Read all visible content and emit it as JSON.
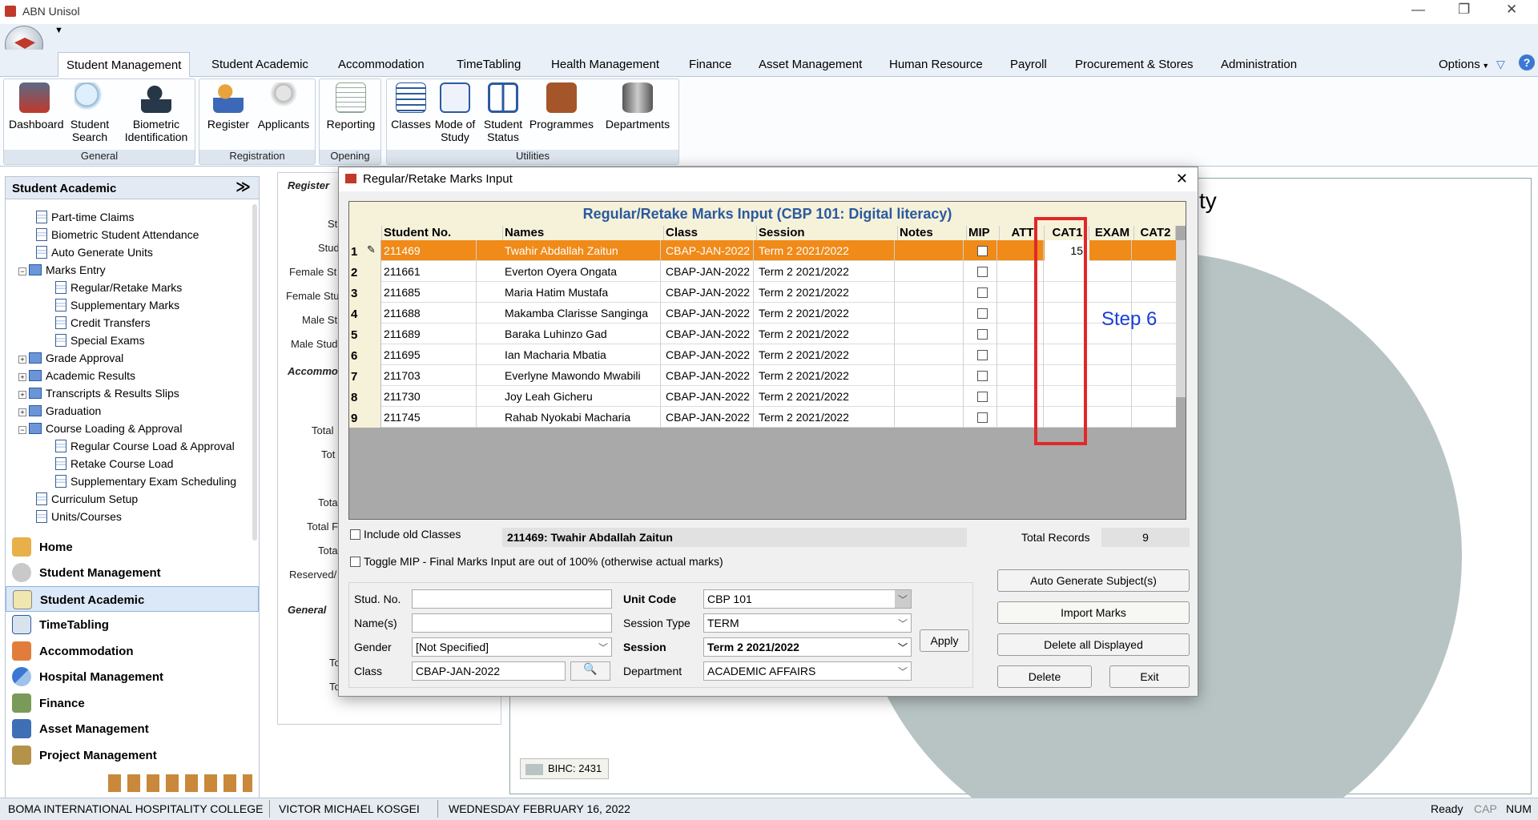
{
  "app": {
    "title": "ABN Unisol"
  },
  "window_controls": {
    "minimize": "—",
    "restore": "❐",
    "close": "✕"
  },
  "tabs": [
    "Student Management",
    "Student Academic",
    "Accommodation",
    "TimeTabling",
    "Health Management",
    "Finance",
    "Asset Management",
    "Human Resource",
    "Payroll",
    "Procurement & Stores",
    "Administration"
  ],
  "options_label": "Options",
  "ribbon": {
    "general": {
      "label": "General",
      "buttons": [
        "Dashboard",
        "Student Search",
        "Biometric Identification"
      ]
    },
    "registration": {
      "label": "Registration",
      "buttons": [
        "Register",
        "Applicants"
      ]
    },
    "opening": {
      "label": "Opening",
      "buttons": [
        "Reporting"
      ]
    },
    "utilities": {
      "label": "Utilities",
      "buttons": [
        "Classes",
        "Mode of Study",
        "Student Status",
        "Programmes",
        "Departments"
      ]
    }
  },
  "left_panel": {
    "title": "Student Academic",
    "tree": [
      "Part-time Claims",
      "Biometric Student Attendance",
      "Auto Generate Units",
      "Marks Entry",
      "Regular/Retake Marks",
      "Supplementary Marks",
      "Credit Transfers",
      "Special Exams",
      "Grade Approval",
      "Academic Results",
      "Transcripts & Results Slips",
      "Graduation",
      "Course Loading & Approval",
      "Regular Course Load & Approval",
      "Retake Course Load",
      "Supplementary Exam Scheduling",
      "Curriculum Setup",
      "Units/Courses"
    ],
    "nav": [
      "Home",
      "Student Management",
      "Student Academic",
      "TimeTabling",
      "Accommodation",
      "Hospital Management",
      "Finance",
      "Asset Management",
      "Project Management"
    ]
  },
  "bg_form": {
    "register": "Register",
    "accommodation": "Accommo",
    "general": "General",
    "labels": [
      "St",
      "Stud",
      "Female St",
      "Female Stu",
      "Male St",
      "Male Stud",
      "Total",
      "Tot",
      "Tota",
      "Total F",
      "Tota",
      "Reserved/",
      "To",
      "To"
    ]
  },
  "chart_bg": {
    "title_fragment": "ty",
    "bihc": "BIHC: 2431"
  },
  "dialog": {
    "title": "Regular/Retake Marks Input",
    "grid_title": "Regular/Retake Marks Input (CBP 101: Digital literacy)",
    "columns": [
      "Student No.",
      "Names",
      "Class",
      "Session",
      "Notes",
      "MIP",
      "ATT",
      "CAT1",
      "EXAM",
      "CAT2"
    ],
    "rows": [
      {
        "n": "1",
        "no": "211469",
        "name": "Twahir Abdallah Zaitun",
        "class": "CBAP-JAN-2022",
        "session": "Term 2 2021/2022",
        "cat1": "15"
      },
      {
        "n": "2",
        "no": "211661",
        "name": "Everton Oyera Ongata",
        "class": "CBAP-JAN-2022",
        "session": "Term 2 2021/2022",
        "cat1": ""
      },
      {
        "n": "3",
        "no": "211685",
        "name": "Maria Hatim Mustafa",
        "class": "CBAP-JAN-2022",
        "session": "Term 2 2021/2022",
        "cat1": ""
      },
      {
        "n": "4",
        "no": "211688",
        "name": "Makamba Clarisse Sanginga",
        "class": "CBAP-JAN-2022",
        "session": "Term 2 2021/2022",
        "cat1": ""
      },
      {
        "n": "5",
        "no": "211689",
        "name": "Baraka Luhinzo Gad",
        "class": "CBAP-JAN-2022",
        "session": "Term 2 2021/2022",
        "cat1": ""
      },
      {
        "n": "6",
        "no": "211695",
        "name": "Ian Macharia Mbatia",
        "class": "CBAP-JAN-2022",
        "session": "Term 2 2021/2022",
        "cat1": ""
      },
      {
        "n": "7",
        "no": "211703",
        "name": "Everlyne Mawondo Mwabili",
        "class": "CBAP-JAN-2022",
        "session": "Term 2 2021/2022",
        "cat1": ""
      },
      {
        "n": "8",
        "no": "211730",
        "name": "Joy Leah Gicheru",
        "class": "CBAP-JAN-2022",
        "session": "Term 2 2021/2022",
        "cat1": ""
      },
      {
        "n": "9",
        "no": "211745",
        "name": "Rahab Nyokabi Macharia",
        "class": "CBAP-JAN-2022",
        "session": "Term 2 2021/2022",
        "cat1": ""
      }
    ],
    "annotation": "Step 6",
    "include_old": "Include old Classes",
    "selected_student": "211469: Twahir Abdallah Zaitun",
    "total_records_label": "Total Records",
    "total_records": "9",
    "toggle_mip": "Toggle MIP - Final Marks Input are out of 100% (otherwise actual marks)",
    "filters": {
      "stud_no_label": "Stud. No.",
      "stud_no": "",
      "names_label": "Name(s)",
      "names": "",
      "gender_label": "Gender",
      "gender": "[Not Specified]",
      "class_label": "Class",
      "class": "CBAP-JAN-2022",
      "unit_code_label": "Unit Code",
      "unit_code": "CBP 101",
      "session_type_label": "Session Type",
      "session_type": "TERM",
      "session_label": "Session",
      "session": "Term 2 2021/2022",
      "department_label": "Department",
      "department": "ACADEMIC AFFAIRS"
    },
    "buttons": {
      "apply": "Apply",
      "auto_generate": "Auto Generate Subject(s)",
      "import": "Import Marks",
      "delete_all": "Delete all Displayed",
      "delete": "Delete",
      "exit": "Exit"
    }
  },
  "status": {
    "college": "BOMA INTERNATIONAL HOSPITALITY COLLEGE",
    "user": "VICTOR MICHAEL KOSGEI",
    "date": "WEDNESDAY FEBRUARY 16, 2022",
    "ready": "Ready",
    "cap": "CAP",
    "num": "NUM"
  }
}
